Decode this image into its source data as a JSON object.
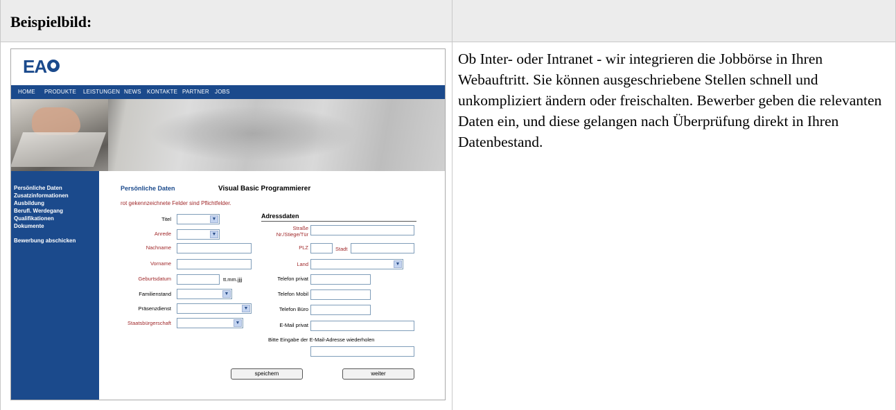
{
  "table": {
    "header_title": "Beispielbild:",
    "description": "Ob Inter- oder Intranet - wir integrieren die Jobbörse in Ihren Webauftritt. Sie können ausgeschriebene Stellen schnell und unkompliziert ändern oder freischalten. Bewerber geben die relevanten Daten ein, und diese gelangen nach Überprüfung direkt in Ihren Datenbestand."
  },
  "site": {
    "logo_text": "EA",
    "nav": [
      "HOME",
      "PRODUKTE",
      "LEISTUNGEN",
      "NEWS",
      "KONTAKTE",
      "PARTNER",
      "JOBS"
    ],
    "sidebar": [
      "Persönliche Daten",
      "Zusatzinformationen",
      "Ausbildung",
      "Berufl. Werdegang",
      "Qualifikationen",
      "Dokumente",
      "Bewerbung abschicken"
    ],
    "colors": {
      "brand": "#1b4a8c",
      "required": "#a0282a"
    }
  },
  "form": {
    "section_label": "Persönliche Daten",
    "job_title": "Visual Basic Programmierer",
    "required_note": "rot gekennzeichnete Felder sind Pflichtfelder.",
    "personal": {
      "titel": "Titel",
      "anrede": "Anrede",
      "nachname": "Nachname",
      "vorname": "Vorname",
      "geburtsdatum": "Geburtsdatum",
      "date_format": "tt.mm.jjjj",
      "familienstand": "Familienstand",
      "praesenzdienst": "Präsenzdienst",
      "staatsbuergerschaft": "Staatsbürgerschaft"
    },
    "address": {
      "heading": "Adressdaten",
      "strasse": "Straße",
      "nr": "Nr./Stiege/Tür",
      "plz": "PLZ",
      "stadt": "Stadt",
      "land": "Land",
      "telefon_privat": "Telefon privat",
      "telefon_mobil": "Telefon Mobil",
      "telefon_buero": "Telefon Büro",
      "email_privat": "E-Mail privat",
      "email_repeat": "Bitte Eingabe der E-Mail-Adresse wiederholen"
    },
    "buttons": {
      "save": "speichern",
      "next": "weiter"
    }
  }
}
